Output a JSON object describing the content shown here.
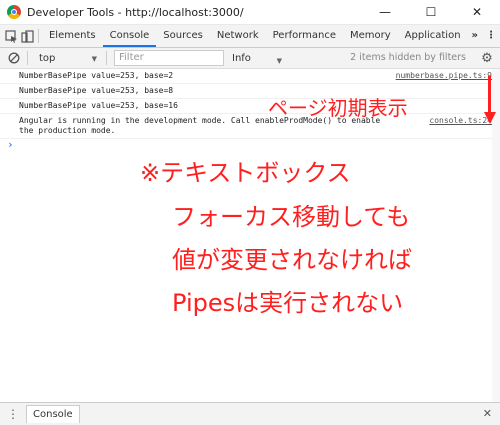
{
  "window": {
    "title": "Developer Tools - http://localhost:3000/",
    "minimize_glyph": "—",
    "maximize_glyph": "☐",
    "close_glyph": "✕"
  },
  "tabs": [
    {
      "label": "Elements"
    },
    {
      "label": "Console"
    },
    {
      "label": "Sources"
    },
    {
      "label": "Network"
    },
    {
      "label": "Performance"
    },
    {
      "label": "Memory"
    },
    {
      "label": "Application"
    }
  ],
  "tab_overflow": "»",
  "more_menu": "⋮",
  "toolbar": {
    "context": "top",
    "filter_placeholder": "Filter",
    "level": "Info",
    "hidden_info": "2 items hidden by filters"
  },
  "console_messages": [
    {
      "text": "NumberBasePipe value=253, base=2",
      "source": "numberbase.pipe.ts:9"
    },
    {
      "text": "NumberBasePipe value=253, base=8",
      "source": ""
    },
    {
      "text": "NumberBasePipe value=253, base=16",
      "source": ""
    },
    {
      "text": "Angular is running in the development mode. Call enableProdMode() to enable the production mode.",
      "source": "console.ts:24"
    }
  ],
  "prompt_glyph": "›",
  "drawer": {
    "menu_glyph": "⋮",
    "tab_label": "Console",
    "close_glyph": "✕"
  },
  "annotations": {
    "page_load": "ページ初期表示",
    "note_line1": "※テキストボックス",
    "note_line2": "フォーカス移動しても",
    "note_line3": "値が変更されなければ",
    "note_line4": "Pipesは実行されない"
  },
  "colors": {
    "annotation_red": "#ff1f1f",
    "accent_blue": "#1a73e8"
  },
  "icons": [
    "chrome-icon",
    "inspect-icon",
    "device-icon",
    "clear-console-icon",
    "settings-icon"
  ]
}
